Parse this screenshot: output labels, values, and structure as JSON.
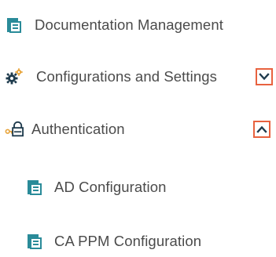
{
  "menu": {
    "items": [
      {
        "label": "Documentation Management",
        "icon": "document-folder-icon"
      },
      {
        "label": "Configurations and Settings",
        "icon": "gears-icon",
        "toggle": "chevron-down-icon",
        "expanded": false
      },
      {
        "label": "Authentication",
        "icon": "key-lock-icon",
        "toggle": "chevron-up-icon",
        "expanded": true
      },
      {
        "label": "AD Configuration",
        "icon": "document-folder-icon"
      },
      {
        "label": "CA PPM Configuration",
        "icon": "document-folder-icon"
      }
    ]
  },
  "colors": {
    "accent": "#e8623f",
    "icon_teal": "#2a8b99",
    "text": "#4b4b4b"
  }
}
